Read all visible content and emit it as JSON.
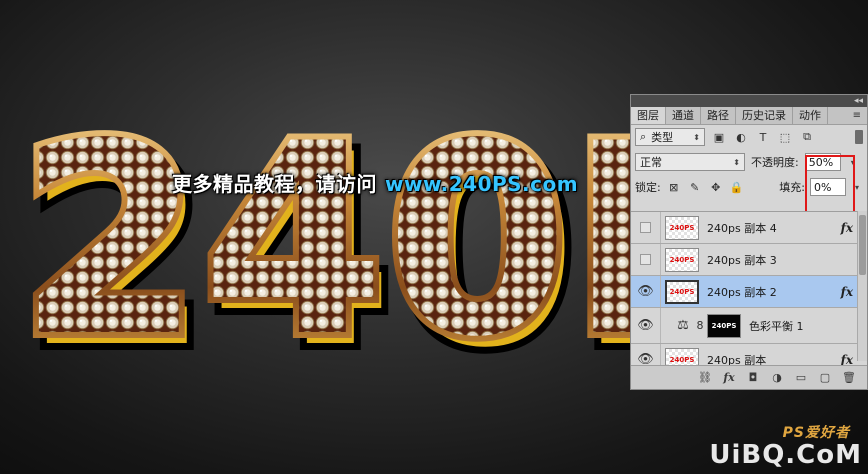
{
  "artwork": {
    "big_text": "240P",
    "banner_cn": "更多精品教程，请访问",
    "banner_url": "www.240PS.com"
  },
  "panel": {
    "collapse_glyph": "◂◂",
    "tabs": [
      {
        "label": "图层",
        "active": true
      },
      {
        "label": "通道",
        "active": false
      },
      {
        "label": "路径",
        "active": false
      },
      {
        "label": "历史记录",
        "active": false
      },
      {
        "label": "动作",
        "active": false
      }
    ],
    "tab_menu_glyph": "≡",
    "filter": {
      "search_glyph": "⌕",
      "label": "类型",
      "spin_glyph": "⬍"
    },
    "filter_icons": [
      "▣",
      "◐",
      "T",
      "⬚",
      "⧉"
    ],
    "blend_mode": "正常",
    "opacity_label": "不透明度:",
    "opacity_value": "50%",
    "lock_label": "锁定:",
    "lock_icons": [
      "⊠",
      "✎",
      "✥",
      "🔒"
    ],
    "fill_label": "填充:",
    "fill_value": "0%",
    "arrow_glyph": "▾",
    "layers": [
      {
        "name": "240ps 副本 4",
        "visible": false,
        "thumb": "240PS",
        "fx": "fx"
      },
      {
        "name": "240ps 副本 3",
        "visible": false,
        "thumb": "240PS",
        "fx": ""
      },
      {
        "name": "240ps 副本 2",
        "visible": true,
        "thumb": "240PS",
        "fx": "fx",
        "selected": true
      },
      {
        "name": "色彩平衡 1",
        "visible": true,
        "thumb": "240PS",
        "adjustment": true
      },
      {
        "name": "240ps 副本",
        "visible": true,
        "thumb": "240PS",
        "fx": "fx"
      }
    ],
    "bottom_icons": [
      "⛓",
      "fx",
      "◘",
      "◑",
      "▭",
      "▢",
      "🗑"
    ],
    "eye_glyph": "👁",
    "adj_glyph": "⚖",
    "chain_glyph": "8"
  },
  "watermark": {
    "text": "UiBQ.CoM",
    "ps": "PS爱好者"
  },
  "colors": {
    "gold": "#c9923a",
    "highlight_red": "#e01818",
    "url_blue": "#35c4ff",
    "selected_layer": "#a9c8ef"
  }
}
